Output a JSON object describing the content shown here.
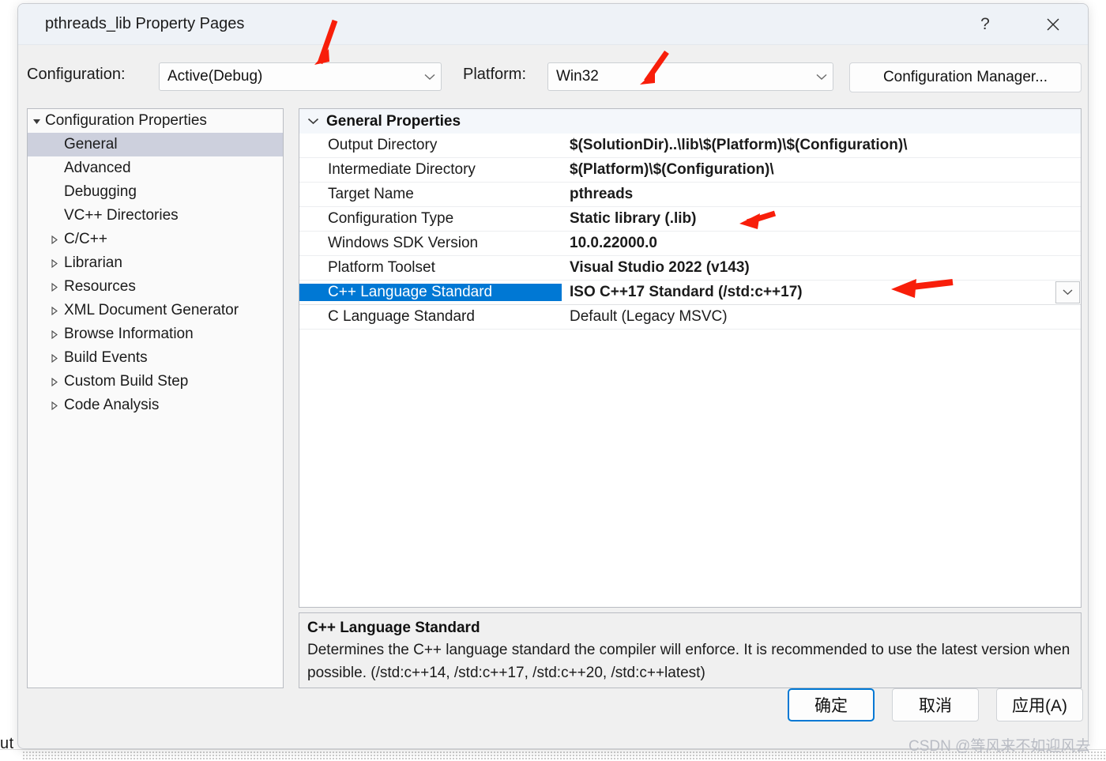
{
  "window": {
    "title": "pthreads_lib Property Pages",
    "help_icon": "question-mark-icon",
    "close_icon": "close-icon",
    "help_label": "?"
  },
  "toolbar": {
    "configuration_label": "Configuration:",
    "configuration_value": "Active(Debug)",
    "platform_label": "Platform:",
    "platform_value": "Win32",
    "config_manager_label": "Configuration Manager..."
  },
  "tree": {
    "items": [
      {
        "label": "Configuration Properties",
        "depth": 0,
        "expander": "expanded",
        "selected": false
      },
      {
        "label": "General",
        "depth": 1,
        "expander": "none",
        "selected": true
      },
      {
        "label": "Advanced",
        "depth": 1,
        "expander": "none",
        "selected": false
      },
      {
        "label": "Debugging",
        "depth": 1,
        "expander": "none",
        "selected": false
      },
      {
        "label": "VC++ Directories",
        "depth": 1,
        "expander": "none",
        "selected": false
      },
      {
        "label": "C/C++",
        "depth": 1,
        "expander": "collapsed",
        "selected": false
      },
      {
        "label": "Librarian",
        "depth": 1,
        "expander": "collapsed",
        "selected": false
      },
      {
        "label": "Resources",
        "depth": 1,
        "expander": "collapsed",
        "selected": false
      },
      {
        "label": "XML Document Generator",
        "depth": 1,
        "expander": "collapsed",
        "selected": false
      },
      {
        "label": "Browse Information",
        "depth": 1,
        "expander": "collapsed",
        "selected": false
      },
      {
        "label": "Build Events",
        "depth": 1,
        "expander": "collapsed",
        "selected": false
      },
      {
        "label": "Custom Build Step",
        "depth": 1,
        "expander": "collapsed",
        "selected": false
      },
      {
        "label": "Code Analysis",
        "depth": 1,
        "expander": "collapsed",
        "selected": false
      }
    ]
  },
  "grid": {
    "group_header": "General Properties",
    "rows": [
      {
        "name": "Output Directory",
        "value": "$(SolutionDir)..\\lib\\$(Platform)\\$(Configuration)\\",
        "selected": false,
        "inherited": false
      },
      {
        "name": "Intermediate Directory",
        "value": "$(Platform)\\$(Configuration)\\",
        "selected": false,
        "inherited": false
      },
      {
        "name": "Target Name",
        "value": "pthreads",
        "selected": false,
        "inherited": false
      },
      {
        "name": "Configuration Type",
        "value": "Static library (.lib)",
        "selected": false,
        "inherited": false
      },
      {
        "name": "Windows SDK Version",
        "value": "10.0.22000.0",
        "selected": false,
        "inherited": false
      },
      {
        "name": "Platform Toolset",
        "value": "Visual Studio 2022 (v143)",
        "selected": false,
        "inherited": false
      },
      {
        "name": "C++ Language Standard",
        "value": "ISO C++17 Standard (/std:c++17)",
        "selected": true,
        "inherited": false
      },
      {
        "name": "C Language Standard",
        "value": "Default (Legacy MSVC)",
        "selected": false,
        "inherited": true
      }
    ]
  },
  "description": {
    "title": "C++ Language Standard",
    "body": "Determines the C++ language standard the compiler will enforce. It is recommended to use the latest version when possible.  (/std:c++14, /std:c++17, /std:c++20, /std:c++latest)"
  },
  "buttons": {
    "ok": "确定",
    "cancel": "取消",
    "apply": "应用(A)"
  },
  "watermark": "CSDN @等风来不如迎风去",
  "backdrop": {
    "clipped_label": "ut"
  },
  "colors": {
    "selection_blue": "#0078d4",
    "annotation_red": "#f81e0a",
    "tree_selection": "#cdd0dd",
    "title_bar": "#eef2f7"
  }
}
